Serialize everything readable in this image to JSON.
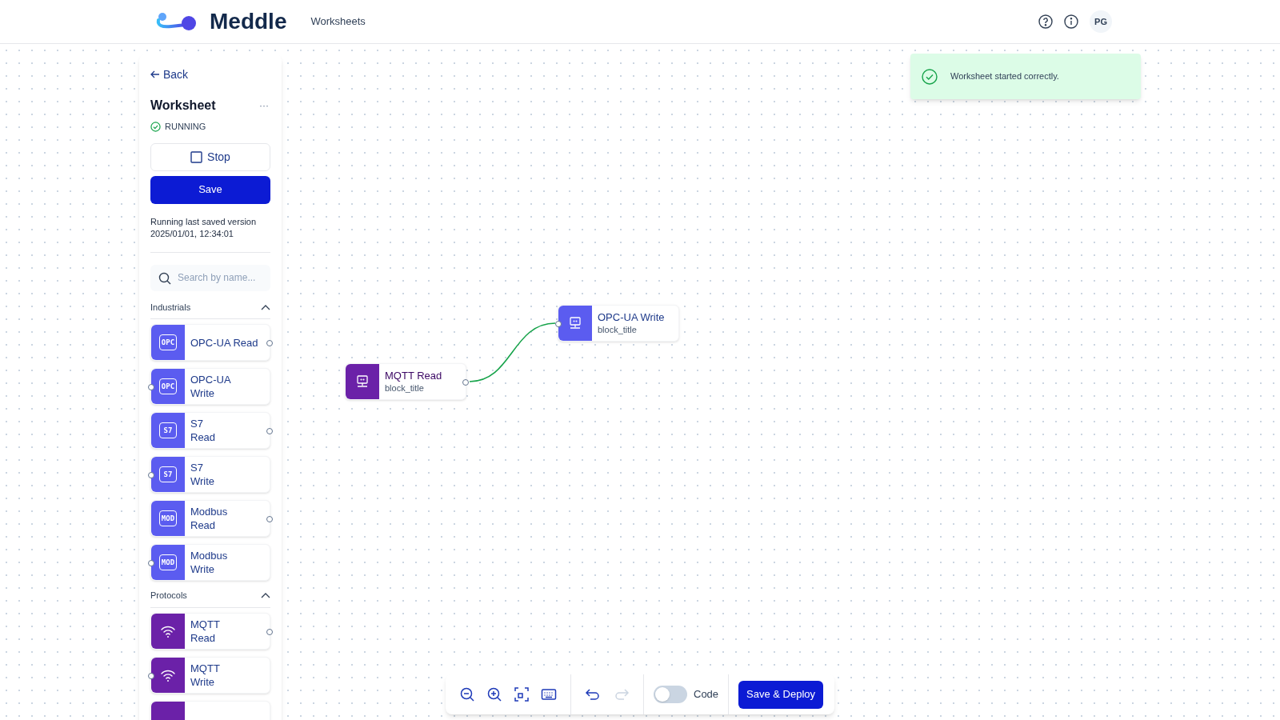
{
  "header": {
    "logo_text": "Meddle",
    "nav": [
      {
        "label": "Worksheets"
      }
    ],
    "avatar": "PG"
  },
  "sidebar": {
    "back": "Back",
    "title": "Worksheet",
    "more": "···",
    "status": "RUNNING",
    "stop": "Stop",
    "save": "Save",
    "saved_info": "Running last saved version",
    "saved_time": "2025/01/01, 12:34:01",
    "search": {
      "placeholder": "Search by name..."
    },
    "categories": [
      {
        "label": "Industrials",
        "expanded": true,
        "items": [
          {
            "lines": [
              "OPC-UA Read"
            ],
            "kind": "chip",
            "badge": "OPC",
            "input_port": false,
            "output_port": true,
            "color": "#5b5cf0"
          },
          {
            "lines": [
              "OPC-UA",
              "Write"
            ],
            "kind": "chip",
            "badge": "OPC",
            "input_port": true,
            "output_port": false,
            "color": "#5b5cf0"
          },
          {
            "lines": [
              "S7",
              "Read"
            ],
            "kind": "chip",
            "badge": "S7",
            "input_port": false,
            "output_port": true,
            "color": "#5b5cf0"
          },
          {
            "lines": [
              "S7",
              "Write"
            ],
            "kind": "chip",
            "badge": "S7",
            "input_port": true,
            "output_port": false,
            "color": "#5b5cf0"
          },
          {
            "lines": [
              "Modbus",
              "Read"
            ],
            "kind": "chip",
            "badge": "MOD",
            "input_port": false,
            "output_port": true,
            "color": "#5b5cf0"
          },
          {
            "lines": [
              "Modbus",
              "Write"
            ],
            "kind": "chip",
            "badge": "MOD",
            "input_port": true,
            "output_port": false,
            "color": "#5b5cf0"
          }
        ]
      },
      {
        "label": "Protocols",
        "expanded": true,
        "items": [
          {
            "lines": [
              "MQTT",
              "Read"
            ],
            "kind": "wifi",
            "input_port": false,
            "output_port": true,
            "color": "#6b21a8"
          },
          {
            "lines": [
              "MQTT",
              "Write"
            ],
            "kind": "wifi",
            "input_port": true,
            "output_port": false,
            "color": "#6b21a8"
          },
          {
            "kind": "blank",
            "color": "#6b21a8"
          }
        ]
      }
    ]
  },
  "toast": {
    "text": "Worksheet started correctly."
  },
  "canvas": {
    "nodes": [
      {
        "title": "MQTT Read",
        "subtitle": "block_title",
        "color": "#6b21a8",
        "input_port": false,
        "output_port": true
      },
      {
        "title": "OPC-UA Write",
        "subtitle": "block_title",
        "color": "#5b5cf0",
        "input_port": true,
        "output_port": false
      }
    ]
  },
  "toolbar": {
    "tools": [
      {
        "kind": "zoom-out",
        "disabled": false
      },
      {
        "kind": "zoom-in",
        "disabled": false
      },
      {
        "kind": "fit",
        "disabled": false
      },
      {
        "kind": "keyboard",
        "disabled": false
      },
      {
        "kind": "undo",
        "disabled": false
      },
      {
        "kind": "redo",
        "disabled": true
      }
    ],
    "code_toggle": {
      "label": "Code",
      "on": false
    },
    "deploy": "Save & Deploy"
  }
}
